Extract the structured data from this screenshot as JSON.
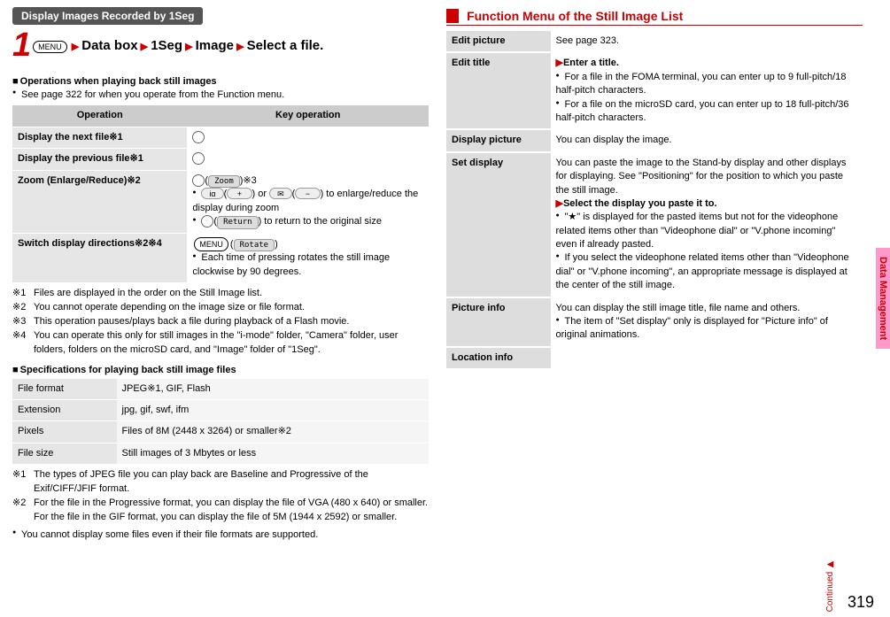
{
  "left": {
    "section_title": "Display Images Recorded by 1Seg",
    "step_menu": "MENU",
    "step_parts": [
      "Data box",
      "1Seg",
      "Image",
      "Select a file."
    ],
    "ops_heading": "Operations when playing back still images",
    "ops_note": "See page 322 for when you operate from the Function menu.",
    "ops_headers": [
      "Operation",
      "Key operation"
    ],
    "ops_rows": [
      {
        "label": "Display the next file※1",
        "key_html": "<span class=\"dir-icon\"></span>"
      },
      {
        "label": "Display the previous file※1",
        "key_html": "<span class=\"dir-icon\"></span>"
      },
      {
        "label": "Zoom (Enlarge/Reduce)※2",
        "key_html": "<span class=\"dir-icon\"></span>(<span class=\"key-icon-text\">Zoom</span>)※3<br><span class=\"bullet\"><span class=\"key-icon\">iα</span>(<span class=\"key-icon\">&nbsp;+&nbsp;</span>) or <span class=\"key-icon\">✉</span>(<span class=\"key-icon\">&nbsp;−&nbsp;</span>) to enlarge/reduce the display during zoom</span><br><span class=\"bullet\"><span class=\"dir-icon\"></span>(<span class=\"key-icon-text\">Return</span>) to return to the original size</span>"
      },
      {
        "label": "Switch display directions※2※4",
        "key_html": "<span class=\"menu-icon\">MENU</span>(<span class=\"key-icon-text\">Rotate</span>)<br><span class=\"bullet\">Each time of pressing rotates the still image clockwise by 90 degrees.</span>"
      }
    ],
    "ops_footnotes": [
      {
        "marker": "※1",
        "text": "Files are displayed in the order on the Still Image list."
      },
      {
        "marker": "※2",
        "text": "You cannot operate depending on the image size or file format."
      },
      {
        "marker": "※3",
        "text": "This operation pauses/plays back a file during playback of a Flash movie."
      },
      {
        "marker": "※4",
        "text": "You can operate this only for still images in the \"i-mode\" folder, \"Camera\" folder, user folders, folders on the microSD card, and \"Image\" folder of \"1Seg\"."
      }
    ],
    "specs_heading": "Specifications for playing back still image files",
    "specs_rows": [
      {
        "label": "File format",
        "value": "JPEG※1, GIF, Flash"
      },
      {
        "label": "Extension",
        "value": "jpg, gif, swf, ifm"
      },
      {
        "label": "Pixels",
        "value": "Files of 8M (2448 x 3264) or smaller※2"
      },
      {
        "label": "File size",
        "value": "Still images of 3 Mbytes or less"
      }
    ],
    "specs_footnotes": [
      {
        "marker": "※1",
        "text": "The types of JPEG file you can play back are Baseline and Progressive of the Exif/CIFF/JFIF format."
      },
      {
        "marker": "※2",
        "text": "For the file in the Progressive format, you can display the file of VGA (480 x 640) or smaller. For the file in the GIF format, you can display the file of 5M (1944 x 2592) or smaller."
      }
    ],
    "specs_tail": "You cannot display some files even if their file formats are supported."
  },
  "right": {
    "title": "Function Menu of the Still Image List",
    "rows": [
      {
        "label": "Edit picture",
        "html": "See page 323."
      },
      {
        "label": "Edit title",
        "html": "<span class=\"arrow\">▶</span><b>Enter a title.</b><br><span class=\"bullet\">For a file in the FOMA terminal, you can enter up to 9 full-pitch/18 half-pitch characters.</span><br><span class=\"bullet\">For a file on the microSD card, you can enter up to 18 full-pitch/36 half-pitch characters.</span>"
      },
      {
        "label": "Display picture",
        "html": "You can display the image."
      },
      {
        "label": "Set display",
        "html": "You can paste the image to the Stand-by display and other displays for displaying. See \"Positioning\" for the position to which you paste the still image.<br><span class=\"arrow\">▶</span><b>Select the display you paste it to.</b><br><span class=\"bullet\">\"★\" is displayed for the pasted items but not for the videophone related items other than \"Videophone dial\" or \"V.phone incoming\" even if already pasted.</span><br><span class=\"bullet\">If you select the videophone related items other than \"Videophone dial\" or \"V.phone incoming\", an appropriate message is displayed at the center of the still image.</span>"
      },
      {
        "label": "Picture info",
        "html": "You can display the still image title, file name and others.<br><span class=\"bullet\">The item of \"Set display\" only is displayed for \"Picture info\" of original animations.</span>"
      },
      {
        "label": "Location info",
        "html": ""
      }
    ]
  },
  "side_tab": "Data Management",
  "continued": "Continued",
  "page_number": "319"
}
